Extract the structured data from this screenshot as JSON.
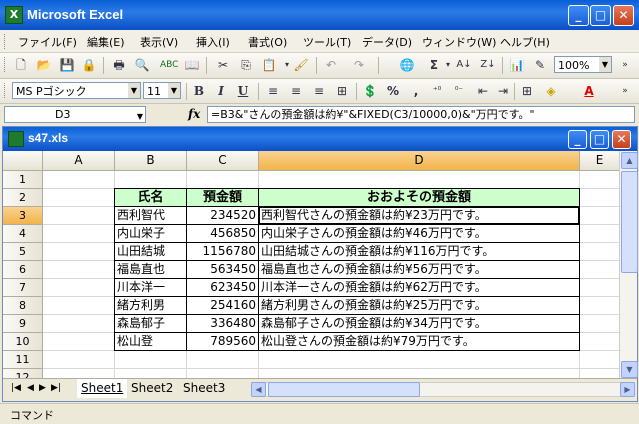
{
  "app": {
    "title": "Microsoft Excel",
    "icon_label": "X"
  },
  "window_buttons": [
    "_",
    "□",
    "✕"
  ],
  "menu": [
    "ファイル(F)",
    "編集(E)",
    "表示(V)",
    "挿入(I)",
    "書式(O)",
    "ツール(T)",
    "データ(D)",
    "ウィンドウ(W)",
    "ヘルプ(H)"
  ],
  "toolbar1": {
    "zoom": "100%"
  },
  "toolbar2": {
    "font": "MS Pゴシック",
    "size": "11",
    "bold": "B",
    "italic": "I",
    "underline": "U",
    "percent": "%",
    "comma": ",",
    "font_color": "A"
  },
  "formula_bar": {
    "name_box": "D3",
    "fx": "fx",
    "formula": "=B3&\"さんの預金額は約¥\"&FIXED(C3/10000,0)&\"万円です。\""
  },
  "workbook": {
    "title": "s47.xls"
  },
  "columns": [
    "A",
    "B",
    "C",
    "D",
    "E"
  ],
  "rows": [
    "1",
    "2",
    "3",
    "4",
    "5",
    "6",
    "7",
    "8",
    "9",
    "10",
    "11",
    "12"
  ],
  "table": {
    "headers": [
      "氏名",
      "預金額",
      "おおよその預金額"
    ],
    "rows": [
      [
        "西利智代",
        "234520",
        "西利智代さんの預金額は約¥23万円です。"
      ],
      [
        "内山栄子",
        "456850",
        "内山栄子さんの預金額は約¥46万円です。"
      ],
      [
        "山田結城",
        "1156780",
        "山田結城さんの預金額は約¥116万円です。"
      ],
      [
        "福島直也",
        "563450",
        "福島直也さんの預金額は約¥56万円です。"
      ],
      [
        "川本洋一",
        "623450",
        "川本洋一さんの預金額は約¥62万円です。"
      ],
      [
        "緒方利男",
        "254160",
        "緒方利男さんの預金額は約¥25万円です。"
      ],
      [
        "森島郁子",
        "336480",
        "森島郁子さんの預金額は約¥34万円です。"
      ],
      [
        "松山登",
        "789560",
        "松山登さんの預金額は約¥79万円です。"
      ]
    ]
  },
  "sheets": [
    "Sheet1",
    "Sheet2",
    "Sheet3"
  ],
  "status": "コマンド"
}
